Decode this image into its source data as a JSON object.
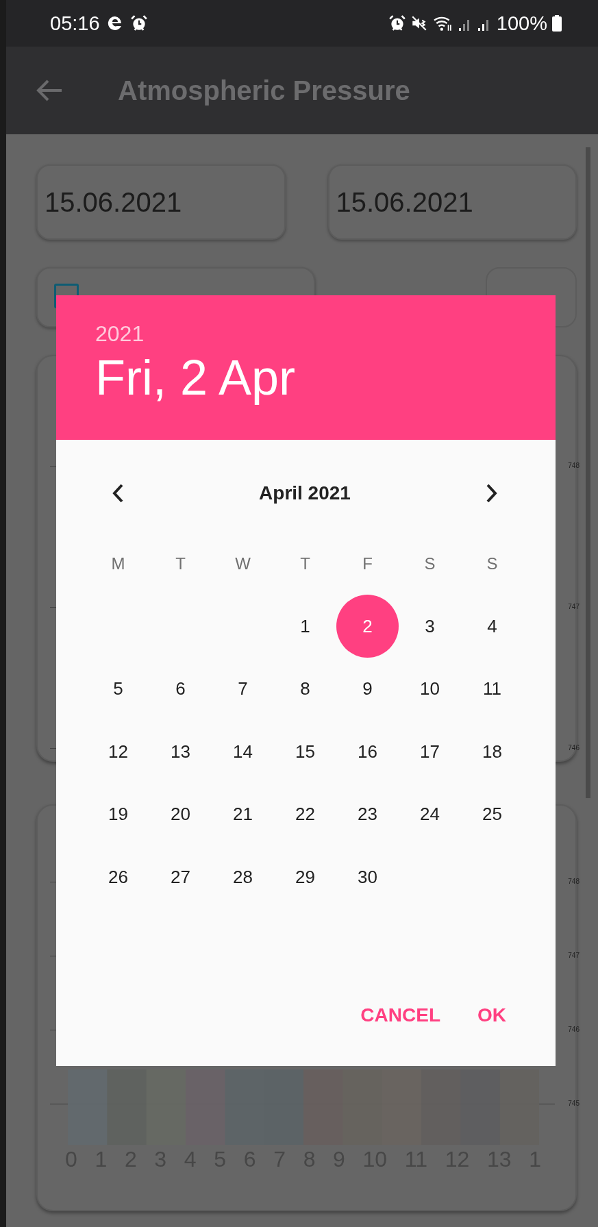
{
  "status_bar": {
    "time": "05:16",
    "battery": "100%"
  },
  "app_bar": {
    "title": "Atmospheric Pressure"
  },
  "date_fields": [
    "15.06.2021",
    "15.06.2021"
  ],
  "charts": [
    {
      "y_labels": [
        "748",
        "747",
        "746"
      ]
    },
    {
      "y_labels": [
        "748",
        "747",
        "746",
        "745"
      ],
      "x_labels": [
        "0",
        "1",
        "2",
        "3",
        "4",
        "5",
        "6",
        "7",
        "8",
        "9",
        "10",
        "11",
        "12",
        "13",
        "1"
      ]
    }
  ],
  "date_picker": {
    "year": "2021",
    "date": "Fri, 2 Apr",
    "month": "April 2021",
    "weekdays": [
      "M",
      "T",
      "W",
      "T",
      "F",
      "S",
      "S"
    ],
    "weeks": [
      [
        {
          "day": "1",
          "selected": false
        },
        {
          "day": "2",
          "selected": true
        },
        {
          "day": "3",
          "selected": false
        },
        {
          "day": "4",
          "selected": false
        }
      ],
      [
        {
          "day": "5",
          "selected": false
        },
        {
          "day": "6",
          "selected": false
        },
        {
          "day": "7",
          "selected": false
        },
        {
          "day": "8",
          "selected": false
        },
        {
          "day": "9",
          "selected": false
        },
        {
          "day": "10",
          "selected": false
        },
        {
          "day": "11",
          "selected": false
        }
      ],
      [
        {
          "day": "12",
          "selected": false
        },
        {
          "day": "13",
          "selected": false
        },
        {
          "day": "14",
          "selected": false
        },
        {
          "day": "15",
          "selected": false
        },
        {
          "day": "16",
          "selected": false
        },
        {
          "day": "17",
          "selected": false
        },
        {
          "day": "18",
          "selected": false
        }
      ],
      [
        {
          "day": "19",
          "selected": false
        },
        {
          "day": "20",
          "selected": false
        },
        {
          "day": "21",
          "selected": false
        },
        {
          "day": "22",
          "selected": false
        },
        {
          "day": "23",
          "selected": false
        },
        {
          "day": "24",
          "selected": false
        },
        {
          "day": "25",
          "selected": false
        }
      ],
      [
        {
          "day": "26",
          "selected": false
        },
        {
          "day": "27",
          "selected": false
        },
        {
          "day": "28",
          "selected": false
        },
        {
          "day": "29",
          "selected": false
        },
        {
          "day": "30",
          "selected": false
        }
      ]
    ],
    "buttons": [
      "CANCEL",
      "OK"
    ]
  }
}
